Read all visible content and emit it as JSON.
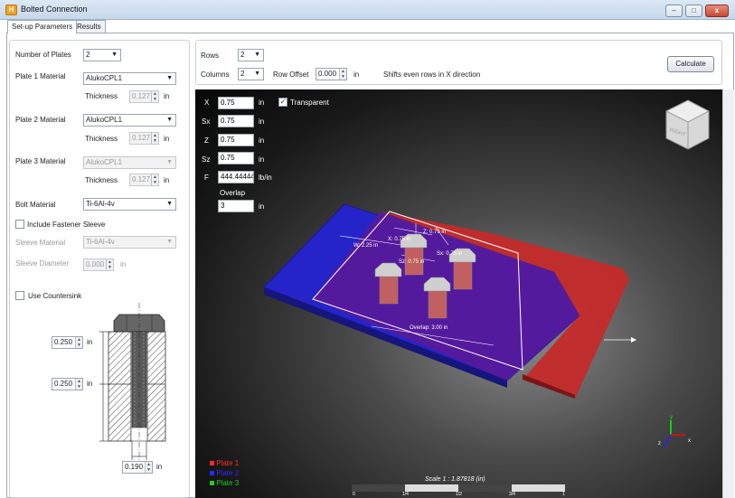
{
  "window": {
    "title": "Bolted Connection",
    "minimize": "–",
    "maximize": "□",
    "close": "x"
  },
  "tabs": [
    {
      "label": "Set-up Parameters"
    },
    {
      "label": "Results"
    }
  ],
  "left": {
    "num_plates_label": "Number of Plates",
    "num_plates_value": "2",
    "plate1_label": "Plate 1 Material",
    "plate1_value": "AlukoCPL1",
    "plate2_label": "Plate 2 Material",
    "plate2_value": "AlukoCPL1",
    "plate3_label": "Plate 3 Material",
    "plate3_value": "AlukoCPL1",
    "thickness_label": "Thickness",
    "thickness1": "0.127",
    "thickness2": "0.127",
    "thickness3": "0.127",
    "unit_in": "in",
    "bolt_material_label": "Bolt Material",
    "bolt_material_value": "Ti-6Al-4v",
    "include_sleeve_label": "Include Fastener Sleeve",
    "sleeve_material_label": "Sleeve Material",
    "sleeve_material_value": "Ti-6Al-4v",
    "sleeve_diameter_label": "Sleeve Diameter",
    "sleeve_diameter_value": "0.000",
    "countersink_label": "Use Countersink",
    "dim1": "0.250",
    "dim2": "0.250",
    "dim3": "0.190"
  },
  "top": {
    "rows_label": "Rows",
    "rows_value": "2",
    "columns_label": "Columns",
    "columns_value": "2",
    "row_offset_label": "Row Offset",
    "row_offset_value": "0.000",
    "row_offset_unit": "in",
    "hint": "Shifts even rows in X direction",
    "calculate": "Calculate"
  },
  "viewport": {
    "x_label": "X",
    "x_value": "0.75",
    "sx_label": "Sx",
    "sx_value": "0.75",
    "z_label": "Z",
    "z_value": "0.75",
    "sz_label": "Sz",
    "sz_value": "0.75",
    "f_label": "F",
    "f_value": "444.44444",
    "f_unit": "lb/in",
    "overlap_label": "Overlap",
    "overlap_value": "3",
    "unit_in": "in",
    "transparent_label": "Transparent",
    "cube_label": "RIGHT",
    "ann_x": "X: 0.75 in",
    "ann_w": "W: 2.25 in",
    "ann_z": "Z: 0.75 in",
    "ann_sx": "Sx: 0.75 in",
    "ann_sz": "Sz: 0.75 in",
    "ann_overlap": "Overlap: 3.00 in",
    "legend": [
      {
        "label": "Plate 1",
        "color": "#ff2a2a"
      },
      {
        "label": "Plate 2",
        "color": "#2a2aff"
      },
      {
        "label": "Plate 3",
        "color": "#22cc22"
      }
    ],
    "scale_text": "Scale 1 : 1.87818 (in)",
    "scale_ticks": [
      "0",
      "1/4",
      "1/2",
      "3/4",
      "1"
    ],
    "axis_y": "y",
    "axis_x": "x",
    "axis_z": "z"
  }
}
